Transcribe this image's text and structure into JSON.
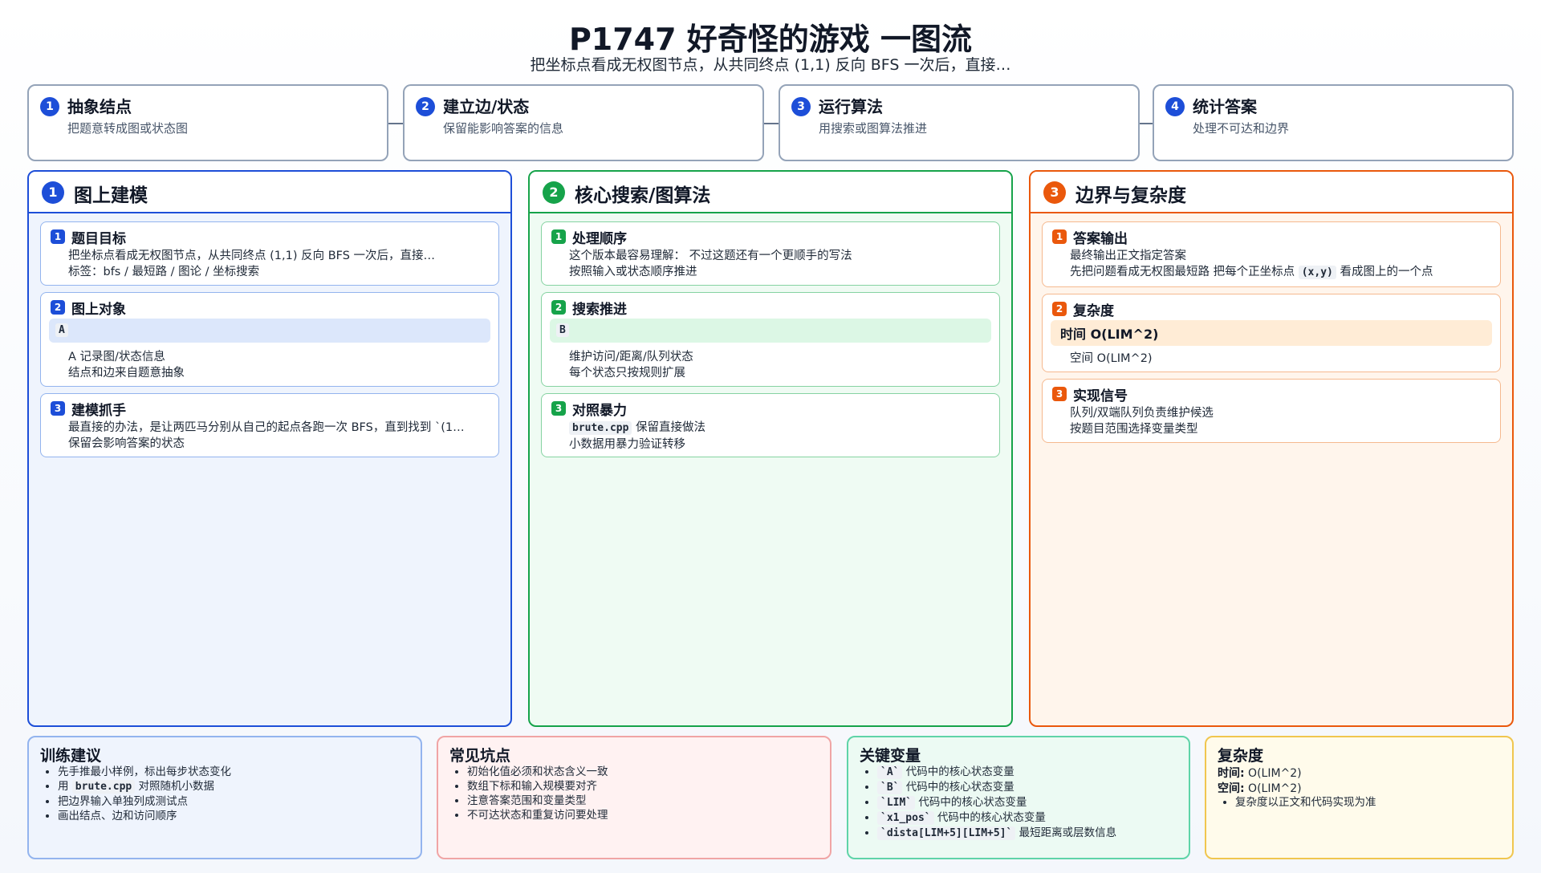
{
  "header": {
    "title": "P1747 好奇怪的游戏 一图流",
    "subtitle": "把坐标点看成无权图节点，从共同终点 (1,1) 反向 BFS 一次后，直接…"
  },
  "steps": [
    {
      "num": "1",
      "title": "抽象结点",
      "desc": "把题意转成图或状态图"
    },
    {
      "num": "2",
      "title": "建立边/状态",
      "desc": "保留能影响答案的信息"
    },
    {
      "num": "3",
      "title": "运行算法",
      "desc": "用搜索或图算法推进"
    },
    {
      "num": "4",
      "title": "统计答案",
      "desc": "处理不可达和边界"
    }
  ],
  "columns": {
    "modeling": {
      "num": "1",
      "title": "图上建模",
      "cards": [
        {
          "num": "1",
          "title": "题目目标",
          "items": [
            "把坐标点看成无权图节点，从共同终点 (1,1) 反向 BFS 一次后，直接…",
            "标签：bfs / 最短路 / 图论 / 坐标搜索"
          ]
        },
        {
          "num": "2",
          "title": "图上对象",
          "bar": "A",
          "items": [
            "A 记录图/状态信息",
            "结点和边来自题意抽象"
          ]
        },
        {
          "num": "3",
          "title": "建模抓手",
          "items": [
            "最直接的办法，是让两匹马分别从自己的起点各跑一次 BFS，直到找到 `(1…",
            "保留会影响答案的状态"
          ]
        }
      ]
    },
    "search": {
      "num": "2",
      "title": "核心搜索/图算法",
      "cards": [
        {
          "num": "1",
          "title": "处理顺序",
          "items": [
            "这个版本最容易理解： 不过这题还有一个更顺手的写法",
            "按照输入或状态顺序推进"
          ]
        },
        {
          "num": "2",
          "title": "搜索推进",
          "bar": "B",
          "items": [
            "维护访问/距离/队列状态",
            "每个状态只按规则扩展"
          ]
        },
        {
          "num": "3",
          "title": "对照暴力",
          "code": "brute.cpp",
          "item1_rest": " 保留直接做法",
          "item2": "小数据用暴力验证转移"
        }
      ]
    },
    "bounds": {
      "num": "3",
      "title": "边界与复杂度",
      "cards": [
        {
          "num": "1",
          "title": "答案输出",
          "item1": "最终输出正文指定答案",
          "item2_pre": "先把问题看成无权图最短路 把每个正坐标点 ",
          "item2_code": "(x,y)",
          "item2_post": " 看成图上的一个点"
        },
        {
          "num": "2",
          "title": "复杂度",
          "bar_text": "时间 O(LIM^2)",
          "items": [
            "空间 O(LIM^2)"
          ]
        },
        {
          "num": "3",
          "title": "实现信号",
          "items": [
            "队列/双端队列负责维护候选",
            "按题目范围选择变量类型"
          ]
        }
      ]
    }
  },
  "bottom": {
    "training": {
      "title": "训练建议",
      "item1": "先手推最小样例，标出每步状态变化",
      "item2_pre": "用 ",
      "item2_code": "brute.cpp",
      "item2_post": " 对照随机小数据",
      "item3": "把边界输入单独列成测试点",
      "item4": "画出结点、边和访问顺序"
    },
    "pitfalls": {
      "title": "常见坑点",
      "items": [
        "初始化值必须和状态含义一致",
        "数组下标和输入规模要对齐",
        "注意答案范围和变量类型",
        "不可达状态和重复访问要处理"
      ]
    },
    "variables": {
      "title": "关键变量",
      "items": [
        {
          "code": "`A`",
          "text": " 代码中的核心状态变量"
        },
        {
          "code": "`B`",
          "text": " 代码中的核心状态变量"
        },
        {
          "code": "`LIM`",
          "text": " 代码中的核心状态变量"
        },
        {
          "code": "`x1_pos`",
          "text": " 代码中的核心状态变量"
        },
        {
          "code": "`dista[LIM+5][LIM+5]`",
          "text": " 最短距离或层数信息"
        }
      ]
    },
    "complexity": {
      "title": "复杂度",
      "time_label": "时间:",
      "time_value": " O(LIM^2)",
      "space_label": "空间:",
      "space_value": " O(LIM^2)",
      "note": "复杂度以正文和代码实现为准"
    }
  },
  "colors": {
    "blue": "#1d4ed8",
    "green": "#16a34a",
    "orange": "#ea580c"
  }
}
